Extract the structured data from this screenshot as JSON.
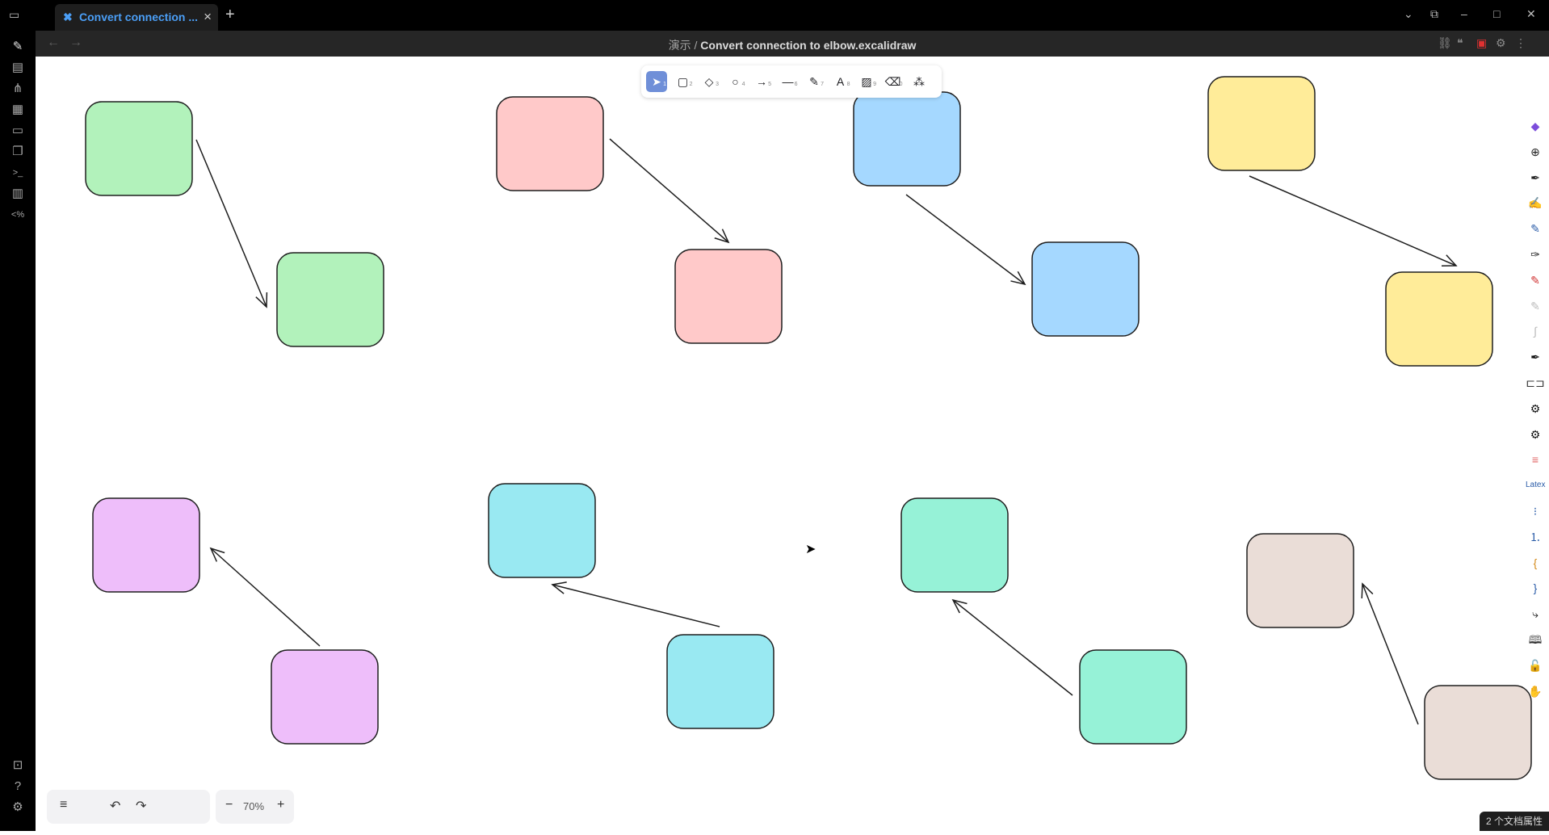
{
  "tab": {
    "title": "Convert connection ...",
    "logo": "excalidraw-logo-icon",
    "close": "×"
  },
  "new_tab": "+",
  "window_controls": {
    "minimize": "–",
    "maximize": "□",
    "close": "✕",
    "menu": "⌄",
    "split": "⧉"
  },
  "breadcrumb": {
    "folder": "演示",
    "sep": " / ",
    "file": "Convert connection to elbow.excalidraw"
  },
  "nav": {
    "back": "←",
    "forward": "→"
  },
  "header_icons": [
    "link-icon",
    "quote-icon",
    "save-icon",
    "gear-icon",
    "more-vertical-icon"
  ],
  "header_icon_glyphs": [
    "⛓",
    "❝",
    "▣",
    "⚙",
    "⋮"
  ],
  "left_sidebar_icons": [
    {
      "name": "excalidraw-icon",
      "glyph": "✎"
    },
    {
      "name": "files-icon",
      "glyph": "▤"
    },
    {
      "name": "graph-icon",
      "glyph": "⋔"
    },
    {
      "name": "grid-icon",
      "glyph": "▦"
    },
    {
      "name": "calendar-icon",
      "glyph": "▭"
    },
    {
      "name": "copy-icon",
      "glyph": "❐"
    },
    {
      "name": "terminal-icon",
      "glyph": ">_"
    },
    {
      "name": "template-icon",
      "glyph": "▥"
    },
    {
      "name": "code-icon",
      "glyph": "<%"
    }
  ],
  "left_sidebar_bottom_icons": [
    {
      "name": "vault-icon",
      "glyph": "⊡"
    },
    {
      "name": "help-icon",
      "glyph": "?"
    },
    {
      "name": "settings-icon",
      "glyph": "⚙"
    }
  ],
  "tools": [
    {
      "name": "selection-tool",
      "glyph": "➤",
      "key": "1",
      "active": true
    },
    {
      "name": "rectangle-tool",
      "glyph": "▢",
      "key": "2"
    },
    {
      "name": "diamond-tool",
      "glyph": "◇",
      "key": "3"
    },
    {
      "name": "ellipse-tool",
      "glyph": "○",
      "key": "4"
    },
    {
      "name": "arrow-tool",
      "glyph": "→",
      "key": "5"
    },
    {
      "name": "line-tool",
      "glyph": "—",
      "key": "6"
    },
    {
      "name": "draw-tool",
      "glyph": "✎",
      "key": "7"
    },
    {
      "name": "text-tool",
      "glyph": "A",
      "key": "8"
    },
    {
      "name": "image-tool",
      "glyph": "▨",
      "key": "9"
    },
    {
      "name": "eraser-tool",
      "glyph": "⌫",
      "key": "0"
    },
    {
      "name": "more-shapes-tool",
      "glyph": "⁂",
      "key": ""
    }
  ],
  "right_tools": [
    {
      "name": "obsidian-icon",
      "glyph": "◆",
      "color": "#7c4ddb"
    },
    {
      "name": "new-file-icon",
      "glyph": "⊕",
      "color": "#222"
    },
    {
      "name": "pen-icon",
      "glyph": "✒",
      "color": "#222"
    },
    {
      "name": "highlighter-icon",
      "glyph": "✍",
      "color": "#d48a1a"
    },
    {
      "name": "marker-icon",
      "glyph": "✎",
      "color": "#2a5ca8"
    },
    {
      "name": "fountain-pen-icon",
      "glyph": "✑",
      "color": "#222"
    },
    {
      "name": "red-pen-icon",
      "glyph": "✎",
      "color": "#d03030"
    },
    {
      "name": "pencil-light-icon",
      "glyph": "✎",
      "color": "#bbbbbb"
    },
    {
      "name": "squiggle-icon",
      "glyph": "∫",
      "color": "#bbbbbb"
    },
    {
      "name": "black-pen-icon",
      "glyph": "✒",
      "color": "#111"
    },
    {
      "name": "connector-icon",
      "glyph": "⊏⊐",
      "color": "#333"
    },
    {
      "name": "gear-a-icon",
      "glyph": "⚙",
      "color": "#111"
    },
    {
      "name": "gear-b-icon",
      "glyph": "⚙",
      "color": "#111"
    },
    {
      "name": "color-lines-icon",
      "glyph": "≡",
      "color": "#e06060"
    },
    {
      "name": "latex-label",
      "glyph": "Latex",
      "color": "#2a5ca8"
    },
    {
      "name": "bullet-list-icon",
      "glyph": "⁝",
      "color": "#2a5ca8"
    },
    {
      "name": "numbered-list-icon",
      "glyph": "⒈",
      "color": "#2a5ca8"
    },
    {
      "name": "brace-left-icon",
      "glyph": "{",
      "color": "#d48a1a"
    },
    {
      "name": "brace-right-icon",
      "glyph": "}",
      "color": "#2a5ca8"
    },
    {
      "name": "elbow-connector-icon",
      "glyph": "⤷",
      "color": "#111"
    },
    {
      "name": "book-icon",
      "glyph": "🕮",
      "color": "#333"
    },
    {
      "name": "lock-icon",
      "glyph": "🔓",
      "color": "#333"
    },
    {
      "name": "hand-icon",
      "glyph": "✋",
      "color": "#333"
    }
  ],
  "bottom": {
    "menu": "≡",
    "undo": "↶",
    "redo": "↷",
    "zoom_out": "−",
    "zoom": "70%",
    "zoom_in": "+"
  },
  "status": "2 个文档属性",
  "colors": {
    "green": "#b2f2bb",
    "red": "#ffc9c9",
    "blue": "#a5d8ff",
    "yellow": "#ffec99",
    "purple": "#eebefa",
    "cyan": "#99e9f2",
    "teal": "#96f2d7",
    "taupe": "#eaddd7",
    "accent": "#4b9ff7"
  },
  "shape_pairs": [
    {
      "color": "green",
      "dir": "forward"
    },
    {
      "color": "red",
      "dir": "forward"
    },
    {
      "color": "blue",
      "dir": "forward"
    },
    {
      "color": "yellow",
      "dir": "forward"
    },
    {
      "color": "purple",
      "dir": "backward"
    },
    {
      "color": "cyan",
      "dir": "backward"
    },
    {
      "color": "teal",
      "dir": "backward"
    },
    {
      "color": "taupe",
      "dir": "backward"
    }
  ]
}
